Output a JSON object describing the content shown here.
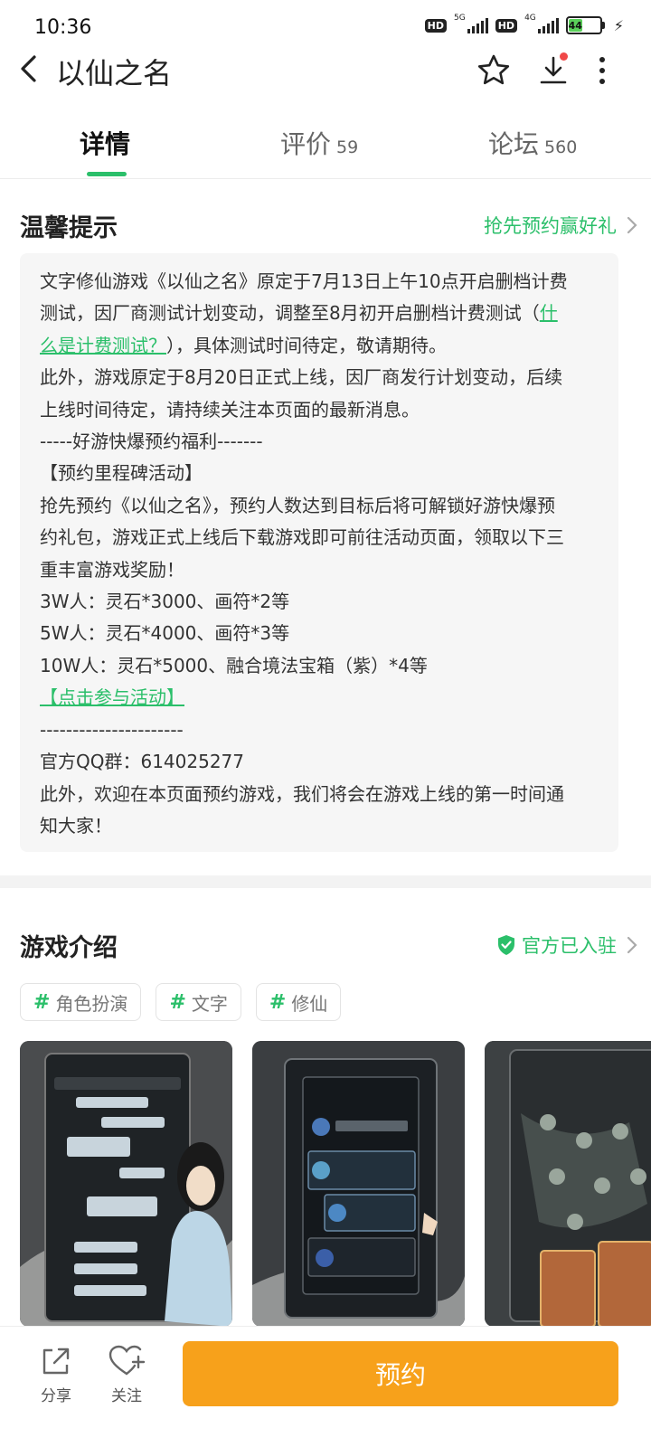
{
  "status_bar": {
    "time": "10:36",
    "network_1": "5G",
    "network_2": "4G",
    "hd_label": "HD",
    "battery": "44"
  },
  "header": {
    "title": "以仙之名",
    "icons": [
      "back-arrow-icon",
      "star-icon",
      "download-icon",
      "more-icon"
    ]
  },
  "tabs": [
    {
      "label": "详情",
      "count": ""
    },
    {
      "label": "评价",
      "count": "59"
    },
    {
      "label": "论坛",
      "count": "560"
    }
  ],
  "notice": {
    "title": "温馨提示",
    "link_label": "抢先预约赢好礼",
    "lines": {
      "l1": "文字修仙游戏《以仙之名》原定于7月13日上午10点开启删档计费",
      "l2a": "测试，因厂商测试计划变动，调整至8月初开启删档计费测试（",
      "l2b": "什",
      "l3a": "么是计费测试？",
      "l3b": "），具体测试时间待定，敬请期待。",
      "l4": "此外，游戏原定于8月20日正式上线，因厂商发行计划变动，后续",
      "l5": "上线时间待定，请持续关注本页面的最新消息。",
      "l6": "-----好游快爆预约福利-------",
      "l7": "【预约里程碑活动】",
      "l8": "抢先预约《以仙之名》，预约人数达到目标后将可解锁好游快爆预",
      "l9": "约礼包，游戏正式上线后下载游戏即可前往活动页面，领取以下三",
      "l10": "重丰富游戏奖励！",
      "l11": "3W人：灵石*3000、画符*2等",
      "l12": "5W人：灵石*4000、画符*3等",
      "l13": "10W人：灵石*5000、融合境法宝箱（紫）*4等",
      "l14": "【点击参与活动】",
      "l15": "----------------------",
      "l16": "官方QQ群：614025277",
      "l17": "此外，欢迎在本页面预约游戏，我们将会在游戏上线的第一时间通",
      "l18": "知大家！"
    }
  },
  "intro": {
    "title": "游戏介绍",
    "official_label": "官方已入驻",
    "tags": [
      {
        "hash": "#",
        "label": "角色扮演"
      },
      {
        "hash": "#",
        "label": "文字"
      },
      {
        "hash": "#",
        "label": "修仙"
      }
    ]
  },
  "bottom_bar": {
    "share_label": "分享",
    "follow_label": "关注",
    "reserve_label": "预约"
  },
  "colors": {
    "accent_green": "#2bbf6a",
    "reserve_orange": "#f7a11b"
  }
}
